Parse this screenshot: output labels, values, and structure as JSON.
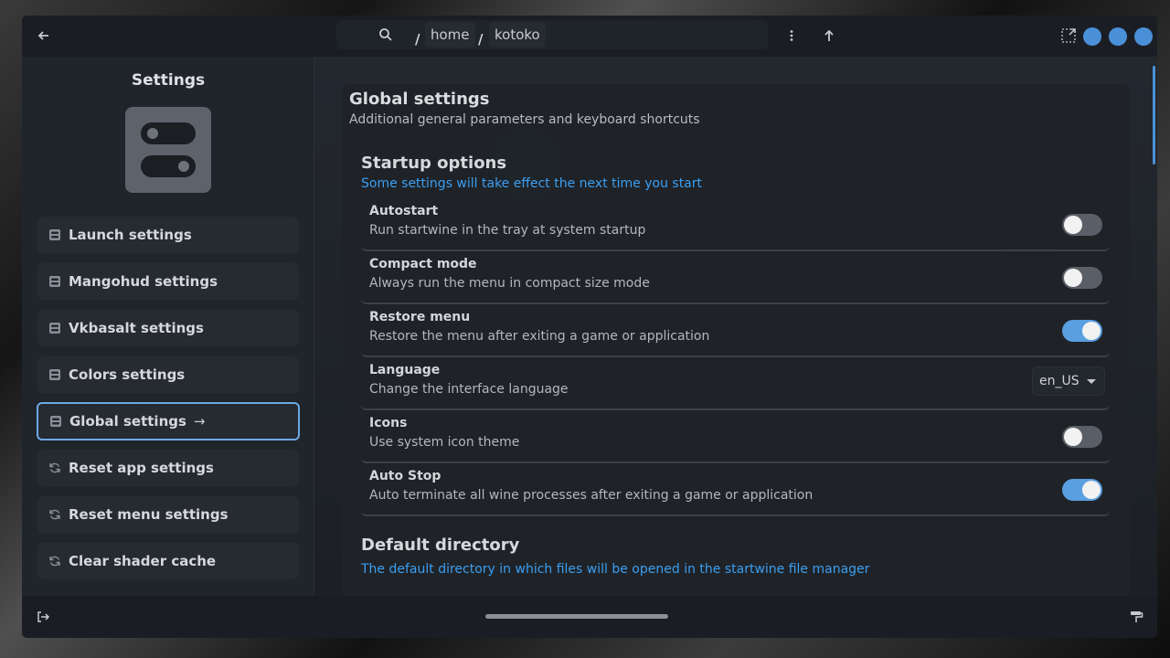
{
  "header": {
    "path": [
      "home",
      "kotoko"
    ],
    "separator": "/"
  },
  "sidebar": {
    "title": "Settings",
    "items": [
      {
        "label": "Launch settings",
        "icon": "settings-icon"
      },
      {
        "label": "Mangohud settings",
        "icon": "settings-icon"
      },
      {
        "label": "Vkbasalt settings",
        "icon": "settings-icon"
      },
      {
        "label": "Colors settings",
        "icon": "settings-icon"
      },
      {
        "label": "Global settings",
        "icon": "settings-icon",
        "active": true
      },
      {
        "label": "Reset app settings",
        "icon": "reset-icon"
      },
      {
        "label": "Reset menu settings",
        "icon": "reset-icon"
      },
      {
        "label": "Clear shader cache",
        "icon": "reset-icon"
      }
    ]
  },
  "main": {
    "title": "Global settings",
    "subtitle": "Additional general parameters and keyboard shortcuts",
    "startup": {
      "title": "Startup options",
      "subtitle": "Some settings will take effect the next time you start",
      "rows": [
        {
          "title": "Autostart",
          "desc": "Run startwine in the tray at system startup",
          "type": "toggle",
          "on": false
        },
        {
          "title": "Compact mode",
          "desc": "Always run the menu in compact size mode",
          "type": "toggle",
          "on": false
        },
        {
          "title": "Restore menu",
          "desc": "Restore the menu after exiting a game or application",
          "type": "toggle",
          "on": true
        },
        {
          "title": "Language",
          "desc": "Change the interface language",
          "type": "dropdown",
          "value": "en_US"
        },
        {
          "title": "Icons",
          "desc": "Use system icon theme",
          "type": "toggle",
          "on": false
        },
        {
          "title": "Auto Stop",
          "desc": "Auto terminate all wine processes after exiting a game or application",
          "type": "toggle",
          "on": true
        }
      ]
    },
    "default_dir": {
      "title": "Default directory",
      "subtitle": "The default directory in which files will be opened in the startwine file manager"
    }
  },
  "colors": {
    "accent": "#4a90d9",
    "link": "#3b9ef0",
    "toggle_on": "#5a9fe0",
    "toggle_off": "#5a5e66"
  }
}
